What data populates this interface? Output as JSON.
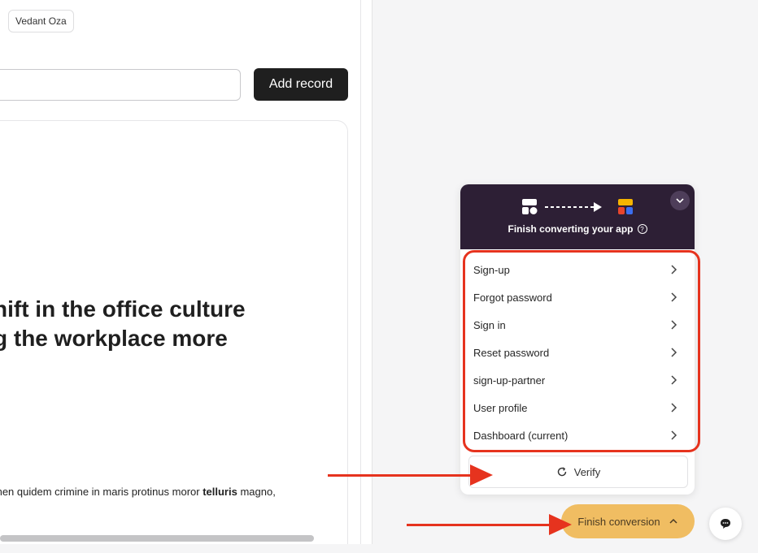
{
  "app": {
    "user_name": "Vedant Oza",
    "add_record_label": "Add record",
    "headline_line1": "hift in the office culture",
    "headline_line2": "g the workplace more",
    "body_before_bold": "men quidem crimine in maris protinus moror ",
    "body_bold": "telluris",
    "body_after_bold": " magno,"
  },
  "panel": {
    "title": "Finish converting your app",
    "help_icon": "?",
    "steps": [
      {
        "label": "Sign-up"
      },
      {
        "label": "Forgot password"
      },
      {
        "label": "Sign in"
      },
      {
        "label": "Reset password"
      },
      {
        "label": "sign-up-partner"
      },
      {
        "label": "User profile"
      },
      {
        "label": "Dashboard (current)"
      }
    ],
    "verify_label": "Verify"
  },
  "finish_button": {
    "label": "Finish conversion"
  },
  "colors": {
    "panel_header": "#2d1f35",
    "highlight": "#e6331e",
    "finish_button": "#f0bd62",
    "add_record_bg": "#1f1f1f"
  }
}
